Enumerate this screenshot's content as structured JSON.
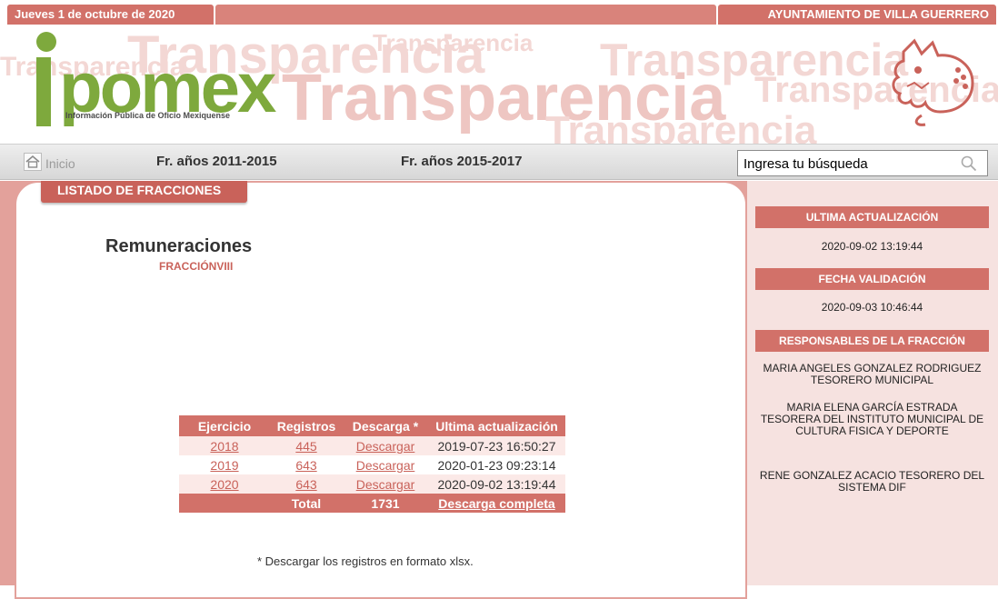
{
  "header": {
    "date": "Jueves 1 de octubre de 2020",
    "organization": "AYUNTAMIENTO DE VILLA GUERRERO"
  },
  "banner": {
    "logo_word": "pomex",
    "logo_subtitle": "Información Pública de Oficio Mexiquense",
    "background_word": "Transparencia",
    "logo_icon": "ipomex-logo",
    "mascot_icon": "dragon-mascot-icon"
  },
  "nav": {
    "home_label": "Inicio",
    "link1": "Fr. años 2011-2015",
    "link2": "Fr. años 2015-2017",
    "search_placeholder": "Ingresa tu búsqueda"
  },
  "main": {
    "tab_label": "LISTADO DE FRACCIONES",
    "title": "Remuneraciones",
    "subtitle": "FRACCIÓNVIII",
    "table": {
      "headers": [
        "Ejercicio",
        "Registros",
        "Descarga *",
        "Ultima actualización"
      ],
      "rows": [
        {
          "ejercicio": "2018",
          "registros": "445",
          "descarga": "Descargar",
          "actualizacion": "2019-07-23 16:50:27"
        },
        {
          "ejercicio": "2019",
          "registros": "643",
          "descarga": "Descargar",
          "actualizacion": "2020-01-23 09:23:14"
        },
        {
          "ejercicio": "2020",
          "registros": "643",
          "descarga": "Descargar",
          "actualizacion": "2020-09-02 13:19:44"
        }
      ],
      "footer": {
        "label": "Total",
        "total": "1731",
        "download": "Descarga completa"
      }
    },
    "note_prefix": "* Descargar los registros en formato ",
    "note_format": "xlsx."
  },
  "sidebar": {
    "last_update_label": "ULTIMA ACTUALIZACIÓN",
    "last_update_value": "2020-09-02 13:19:44",
    "validation_label": "FECHA VALIDACIÓN",
    "validation_value": "2020-09-03 10:46:44",
    "responsables_label": "RESPONSABLES DE LA FRACCIÓN",
    "responsables": [
      "MARIA ANGELES GONZALEZ RODRIGUEZ TESORERO MUNICIPAL",
      "MARIA ELENA GARCÍA ESTRADA TESORERA DEL INSTITUTO MUNICIPAL DE CULTURA FISICA Y DEPORTE",
      "RENE GONZALEZ ACACIO TESORERO DEL SISTEMA DIF"
    ]
  },
  "colors": {
    "accent": "#d27169",
    "accent_dark": "#c9625a",
    "logo_green": "#7ea93d",
    "sidebar_bg": "#f6e2e0"
  }
}
